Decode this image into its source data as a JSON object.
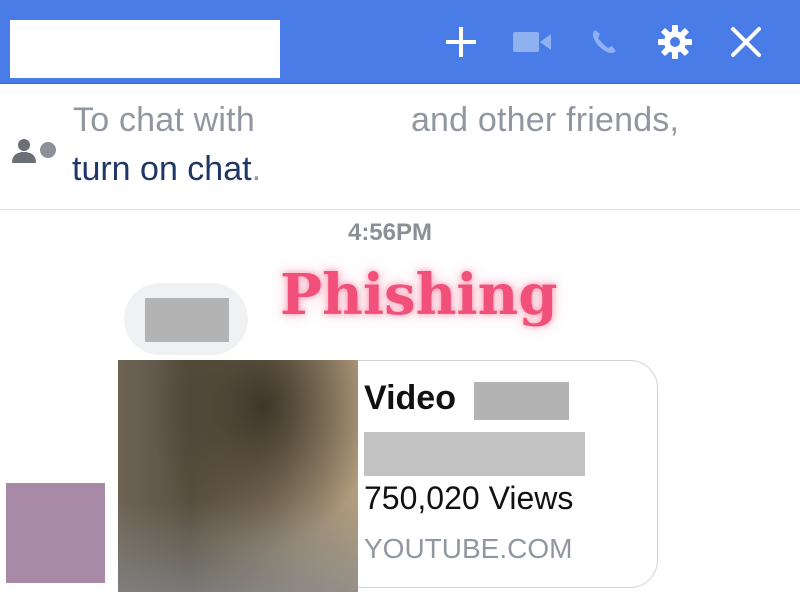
{
  "header": {
    "background_color": "#4a7ce8",
    "icons": [
      "plus-icon",
      "video-icon",
      "phone-icon",
      "gear-icon",
      "close-icon"
    ]
  },
  "notice": {
    "text_before": "To chat with",
    "text_after": "and other friends,",
    "link_text": "turn on chat",
    "link_suffix": ".",
    "link_color": "#1f3766"
  },
  "conversation": {
    "timestamp": "4:56PM",
    "overlay_label": "Phishing",
    "overlay_color": "#f0507a"
  },
  "link_card": {
    "title": "Video",
    "views": "750,020 Views",
    "domain": "YOUTUBE.COM"
  }
}
